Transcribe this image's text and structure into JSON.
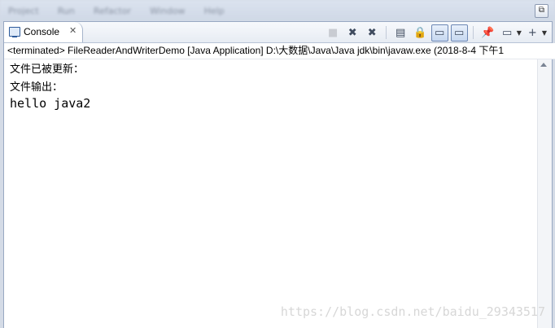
{
  "menu_blur": [
    "Project",
    "Run",
    "Refactor",
    "Window",
    "Help"
  ],
  "window": {
    "restore_glyph": "⧉"
  },
  "console_tab": {
    "label": "Console",
    "close_glyph": "✕",
    "icon": "console-icon"
  },
  "toolbar": [
    {
      "name": "terminate-icon",
      "glyph": "■",
      "state": "disabled"
    },
    {
      "name": "remove-launch-icon",
      "glyph": "✖",
      "state": "normal"
    },
    {
      "name": "remove-all-terminated-icon",
      "glyph": "✖",
      "state": "normal"
    },
    {
      "name": "clear-console-icon",
      "glyph": "▤",
      "state": "normal"
    },
    {
      "name": "scroll-lock-icon",
      "glyph": "🔒",
      "state": "normal"
    },
    {
      "name": "show-on-stdout-icon",
      "glyph": "▭",
      "state": "pressed"
    },
    {
      "name": "show-on-stderr-icon",
      "glyph": "▭",
      "state": "pressed"
    },
    {
      "name": "pin-console-icon",
      "glyph": "📌",
      "state": "normal"
    },
    {
      "name": "display-selected-console-icon",
      "glyph": "▭",
      "state": "normal"
    },
    {
      "name": "open-console-icon",
      "glyph": "+",
      "state": "normal"
    }
  ],
  "status": "<terminated> FileReaderAndWriterDemo [Java Application] D:\\大数据\\Java\\Java jdk\\bin\\javaw.exe (2018-8-4 下午1",
  "output": [
    "文件已被更新：",
    "文件输出：",
    "hello java2"
  ],
  "watermark": "https://blog.csdn.net/baidu_29343517"
}
